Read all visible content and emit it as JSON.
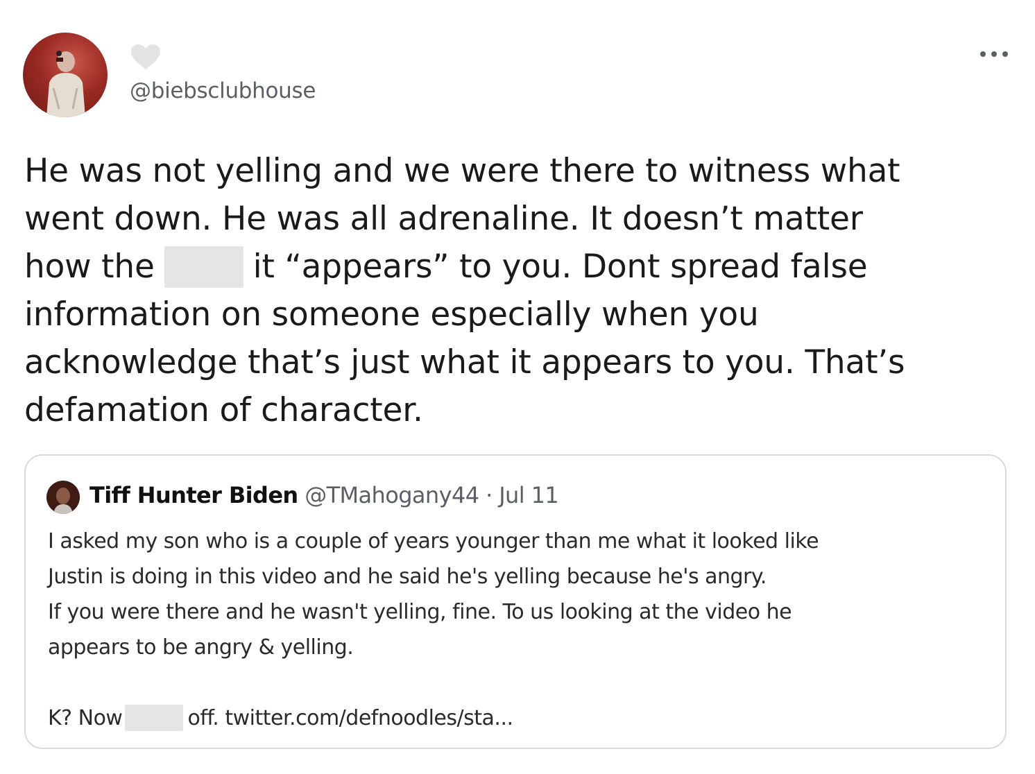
{
  "tweet": {
    "handle": "@biebsclubhouse",
    "avatar_icon": "profile-photo",
    "like_icon": "heart-icon",
    "menu_icon": "more-dots-icon",
    "text_lines": {
      "l1": "He was not yelling and we were there to witness what",
      "l2": "went down. He was all adrenaline. It doesn’t matter",
      "l3a": "how the",
      "l3b": "it “appears” to you. Dont spread false",
      "l4": "information on someone especially when you",
      "l5": "acknowledge that’s just what it appears to you. That’s",
      "l6": "defamation of character."
    }
  },
  "quoted_tweet": {
    "name": "Tiff Hunter Biden",
    "handle": "@TMahogany44",
    "separator": "·",
    "date": "Jul 11",
    "text_lines": {
      "l1": "I asked my son who is a couple of years younger than me what it looked like",
      "l2": "Justin is doing in this video and he said he's yelling because he's angry.",
      "l3": "If you were there and he wasn't yelling, fine. To us looking at the video he",
      "l4": "appears to be angry & yelling.",
      "l5a": "K? Now",
      "l5b": "off.",
      "link": "twitter.com/defnoodles/sta..."
    }
  },
  "colors": {
    "text": "#1a1a1a",
    "secondary": "#5a5f66",
    "border": "#d6dbe0",
    "redaction": "#e5e5e5",
    "avatar_red": "#9b2a24"
  }
}
